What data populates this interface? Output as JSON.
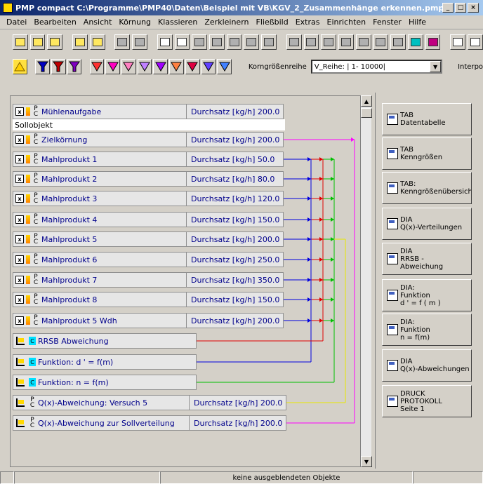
{
  "window": {
    "title": "PMP compact  C:\\Programme\\PMP40\\Daten\\Beispiel mit VB\\KGV_2_Zusammenhänge erkennen.pmp",
    "buttons": [
      "_",
      "□",
      "×"
    ]
  },
  "menu": [
    "Datei",
    "Bearbeiten",
    "Ansicht",
    "Körnung",
    "Klassieren",
    "Zerkleinern",
    "Fließbild",
    "Extras",
    "Einrichten",
    "Fenster",
    "Hilfe"
  ],
  "toolbar2": {
    "korn_label": "Korngrößenreihe",
    "korn_value": "V_Reihe: | 1- 10000|",
    "interp_label": "Interpo"
  },
  "rows": [
    {
      "name": "Mühlenaufgabe",
      "value": "Durchsatz [kg/h] 200.0"
    },
    {
      "name": "Zielkörnung",
      "value": "Durchsatz [kg/h] 200.0"
    },
    {
      "name": "Mahlprodukt 1",
      "value": "Durchsatz [kg/h] 50.0"
    },
    {
      "name": "Mahlprodukt 2",
      "value": "Durchsatz [kg/h] 80.0"
    },
    {
      "name": "Mahlprodukt 3",
      "value": "Durchsatz [kg/h] 120.0"
    },
    {
      "name": "Mahlprodukt 4",
      "value": "Durchsatz [kg/h] 150.0"
    },
    {
      "name": "Mahlprodukt 5",
      "value": "Durchsatz [kg/h] 200.0"
    },
    {
      "name": "Mahlprodukt 6",
      "value": "Durchsatz [kg/h] 250.0"
    },
    {
      "name": "Mahlprodukt 7",
      "value": "Durchsatz [kg/h] 350.0"
    },
    {
      "name": "Mahlprodukt 8",
      "value": "Durchsatz [kg/h] 150.0"
    },
    {
      "name": "Mahlprodukt 5  Wdh",
      "value": "Durchsatz [kg/h] 200.0"
    }
  ],
  "sollobjekt": "Sollobjekt",
  "functions": [
    {
      "name": "RRSB Abweichung"
    },
    {
      "name": "Funktion: d ' = f(m)"
    },
    {
      "name": "Funktion: n = f(m)"
    }
  ],
  "qx_rows": [
    {
      "name": "Q(x)-Abweichung: Versuch 5",
      "value": "Durchsatz [kg/h] 200.0"
    },
    {
      "name": "Q(x)-Abweichung zur Sollverteilung",
      "value": "Durchsatz [kg/h] 200.0"
    }
  ],
  "right_buttons": [
    {
      "label": "TAB\nDatentabelle"
    },
    {
      "label": "TAB\nKenngrößen"
    },
    {
      "label": "TAB:\nKenngrößenübersicht"
    },
    {
      "label": "DIA\nQ(x)-Verteilungen"
    },
    {
      "label": "DIA\nRRSB -\nAbweichung"
    },
    {
      "label": "DIA:\nFunktion\nd ' = f ( m )"
    },
    {
      "label": "DIA:\nFunktion\nn = f(m)"
    },
    {
      "label": "DIA\nQ(x)-Abweichungen"
    },
    {
      "label": "DRUCK\nPROTOKOLL\nSeite 1"
    }
  ],
  "status": {
    "text": "keine ausgeblendeten Objekte"
  },
  "colors": {
    "red": "#e00000",
    "blue": "#0000e0",
    "green": "#00c000",
    "yellow": "#e8e800",
    "magenta": "#ff00ff"
  }
}
